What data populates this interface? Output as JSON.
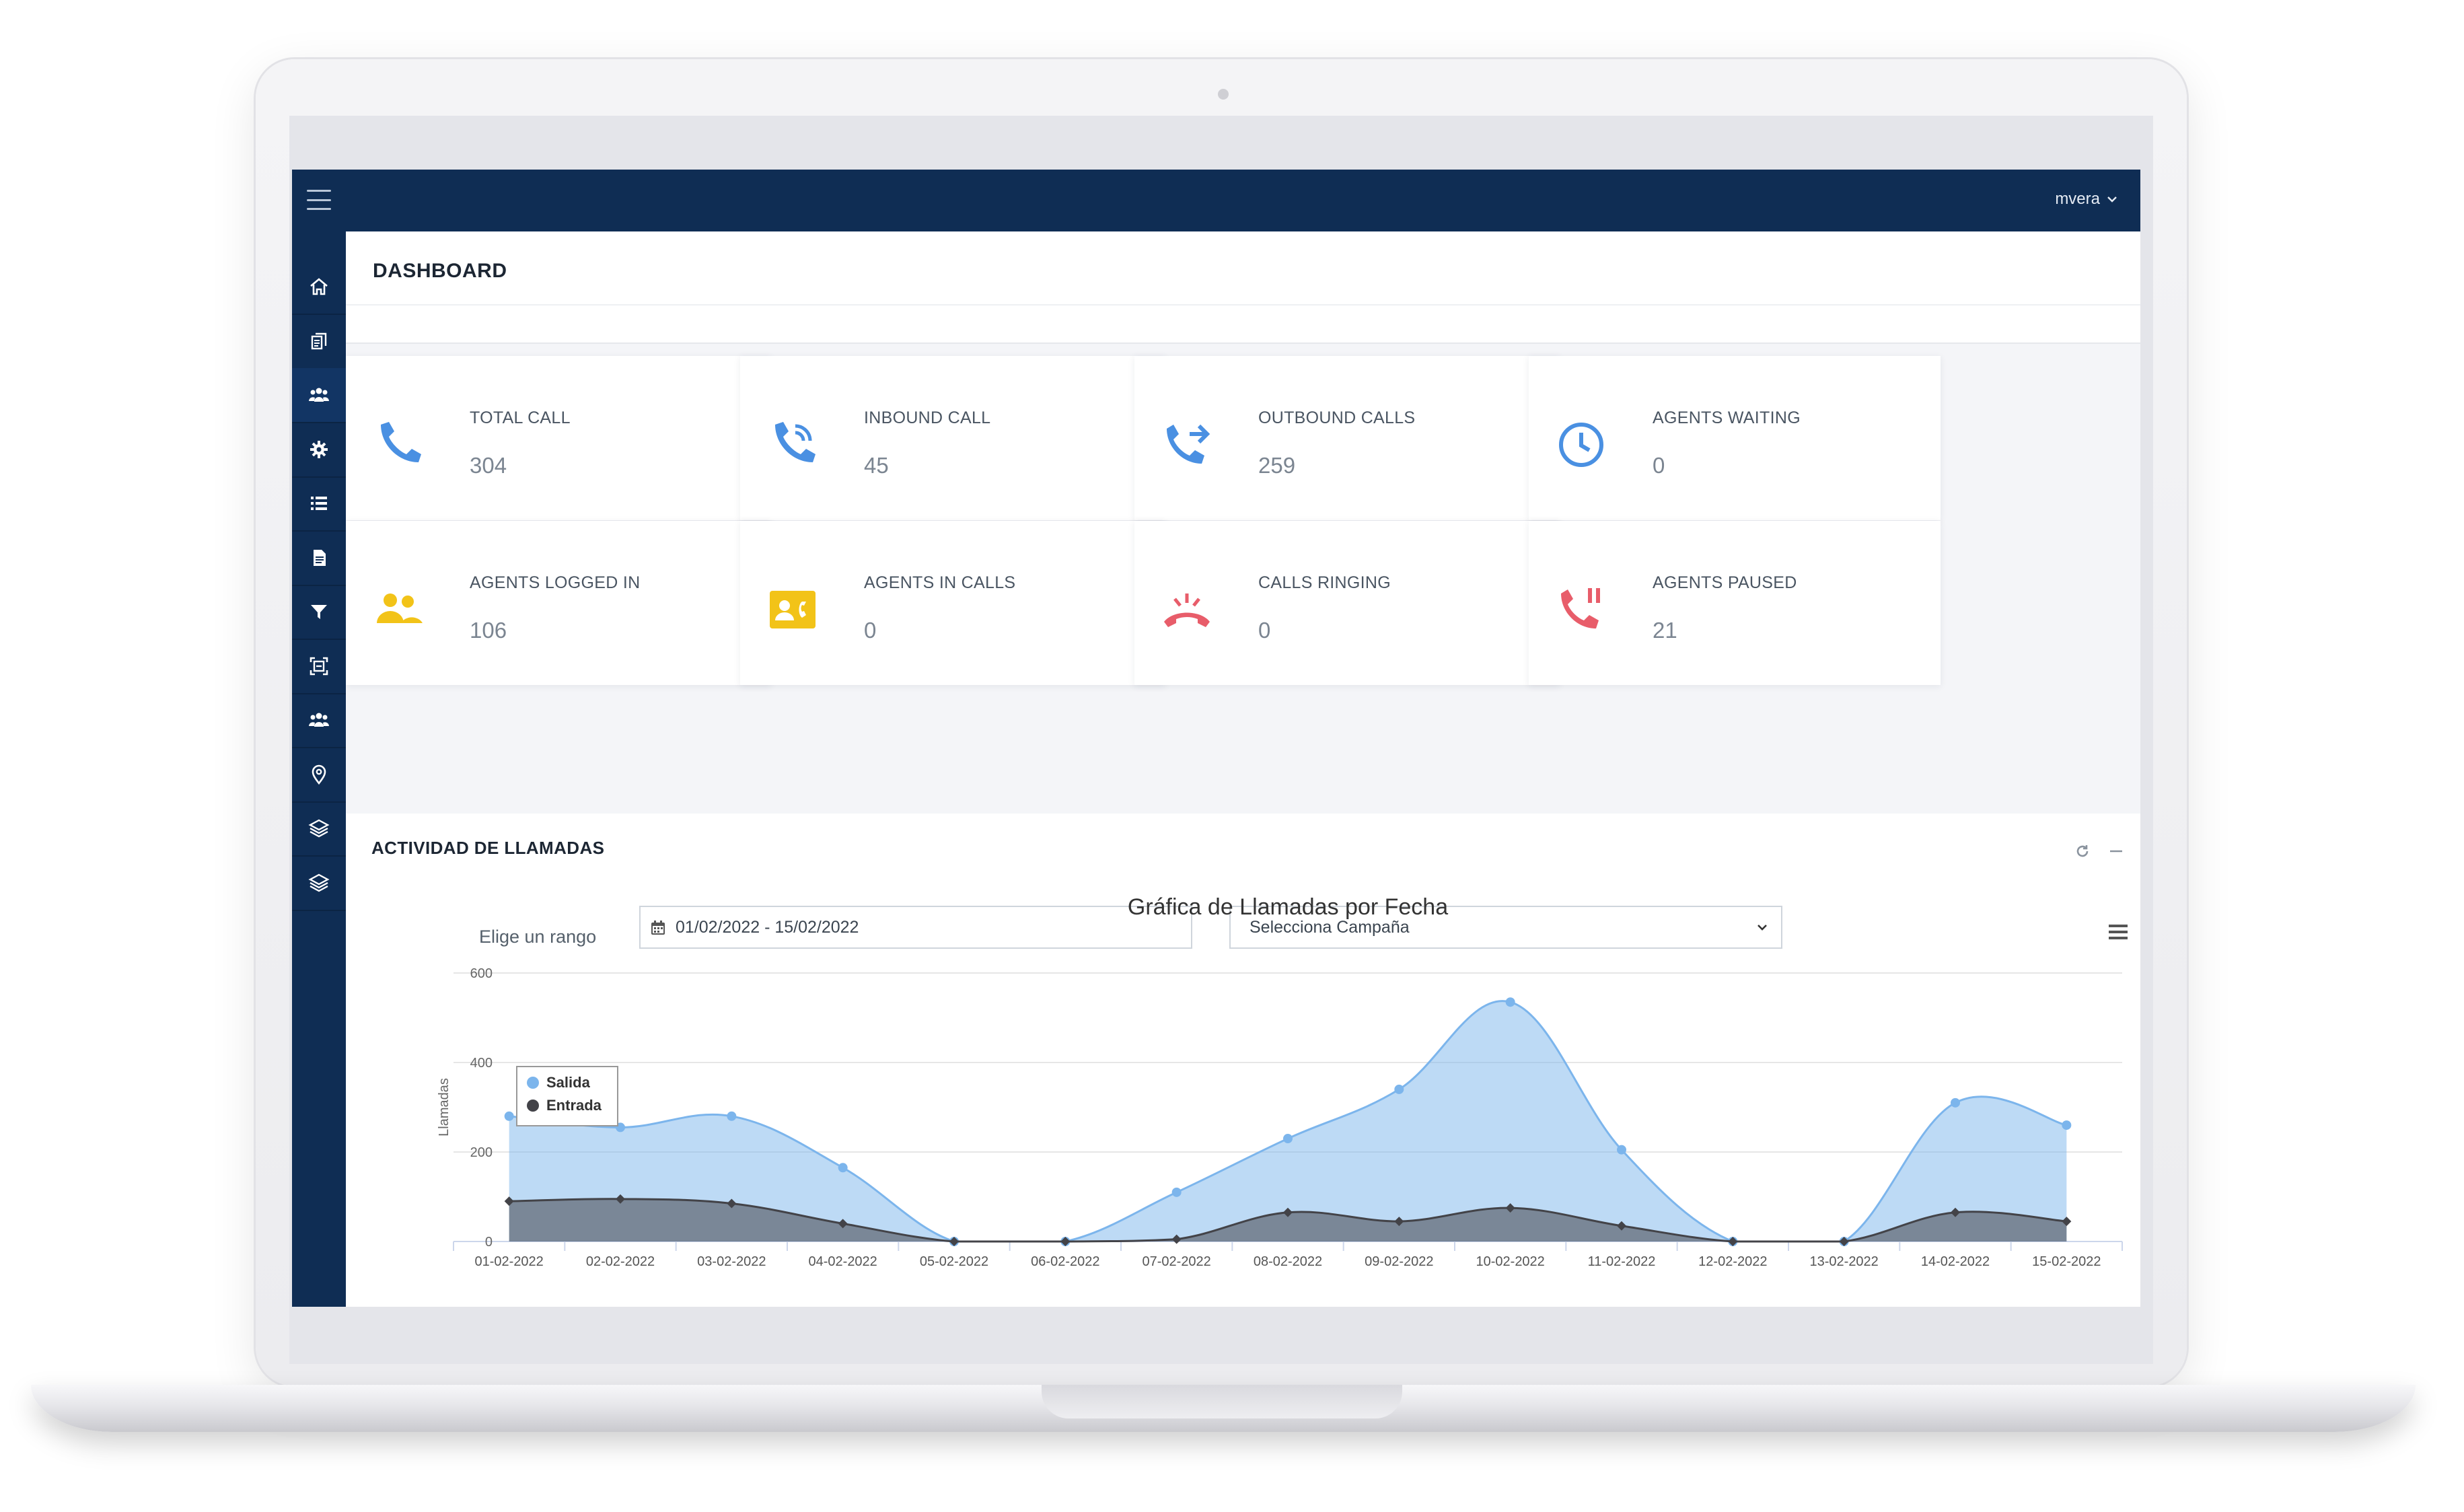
{
  "topbar": {
    "user": "mvera"
  },
  "sidebar": {
    "items": [
      {
        "icon": "home-icon"
      },
      {
        "icon": "documents-icon"
      },
      {
        "icon": "users-icon"
      },
      {
        "icon": "gear-icon"
      },
      {
        "icon": "list-icon"
      },
      {
        "icon": "file-icon"
      },
      {
        "icon": "filter-icon"
      },
      {
        "icon": "scan-icon"
      },
      {
        "icon": "group-icon"
      },
      {
        "icon": "location-pin-icon"
      },
      {
        "icon": "layers-icon"
      },
      {
        "icon": "layers-alt-icon"
      }
    ],
    "active_index": 2
  },
  "page": {
    "title": "DASHBOARD"
  },
  "stats": [
    {
      "label": "TOTAL CALL",
      "value": "304",
      "icon": "phone-icon",
      "color": "#4a90e2"
    },
    {
      "label": "INBOUND CALL",
      "value": "45",
      "icon": "phone-incoming-icon",
      "color": "#4a90e2"
    },
    {
      "label": "OUTBOUND CALLS",
      "value": "259",
      "icon": "phone-outgoing-icon",
      "color": "#4a90e2"
    },
    {
      "label": "AGENTS WAITING",
      "value": "0",
      "icon": "clock-icon",
      "color": "#4a90e2"
    },
    {
      "label": "AGENTS LOGGED IN",
      "value": "106",
      "icon": "agents-icon",
      "color": "#f2c318"
    },
    {
      "label": "AGENTS IN CALLS",
      "value": "0",
      "icon": "contact-card-icon",
      "color": "#f2c318"
    },
    {
      "label": "CALLS RINGING",
      "value": "0",
      "icon": "phone-ringing-icon",
      "color": "#e85d6a"
    },
    {
      "label": "AGENTS PAUSED",
      "value": "21",
      "icon": "phone-paused-icon",
      "color": "#e85d6a"
    }
  ],
  "activity": {
    "title": "ACTIVIDAD DE LLAMADAS",
    "range_label": "Elige un rango",
    "date_range": "01/02/2022 - 15/02/2022",
    "campaign_select": "Selecciona Campaña"
  },
  "chart_data": {
    "type": "area",
    "title": "Gráfica de Llamadas por Fecha",
    "xlabel": "",
    "ylabel": "Llamadas",
    "ylim": [
      0,
      600
    ],
    "yticks": [
      0,
      200,
      400,
      600
    ],
    "grid": true,
    "legend_placement": "top-left",
    "categories": [
      "01-02-2022",
      "02-02-2022",
      "03-02-2022",
      "04-02-2022",
      "05-02-2022",
      "06-02-2022",
      "07-02-2022",
      "08-02-2022",
      "09-02-2022",
      "10-02-2022",
      "11-02-2022",
      "12-02-2022",
      "13-02-2022",
      "14-02-2022",
      "15-02-2022"
    ],
    "series": [
      {
        "name": "Salida",
        "color": "#7cb5ec",
        "values": [
          280,
          255,
          280,
          165,
          0,
          0,
          110,
          230,
          340,
          535,
          205,
          0,
          0,
          310,
          260
        ]
      },
      {
        "name": "Entrada",
        "color": "#434348",
        "values": [
          90,
          95,
          85,
          40,
          0,
          0,
          5,
          65,
          45,
          75,
          35,
          0,
          0,
          65,
          45
        ]
      }
    ]
  }
}
